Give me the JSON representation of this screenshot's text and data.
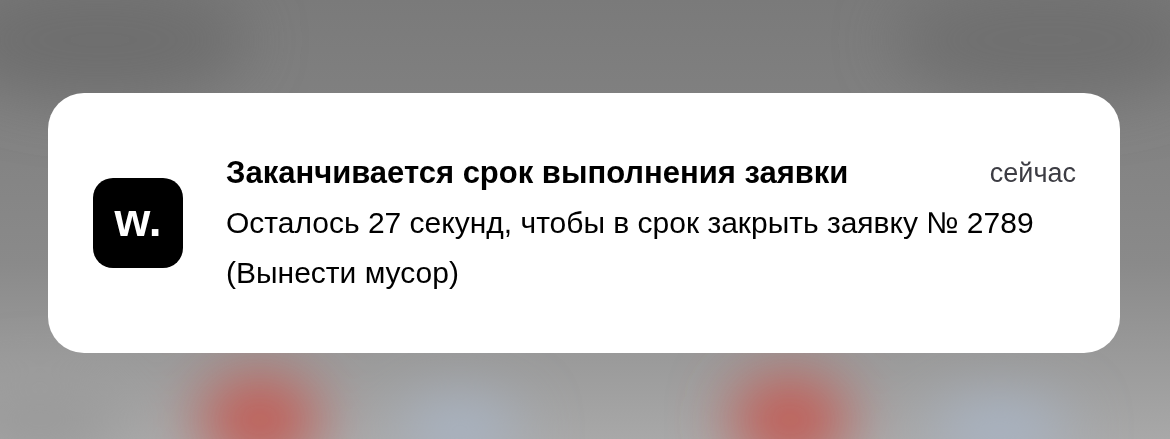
{
  "notification": {
    "app_icon": "w.",
    "title": "Заканчивается срок выполнения заявки",
    "time": "сейчас",
    "body": "Осталось 27 секунд, чтобы в срок закрыть заявку № 2789 (Вынести мусор)"
  }
}
